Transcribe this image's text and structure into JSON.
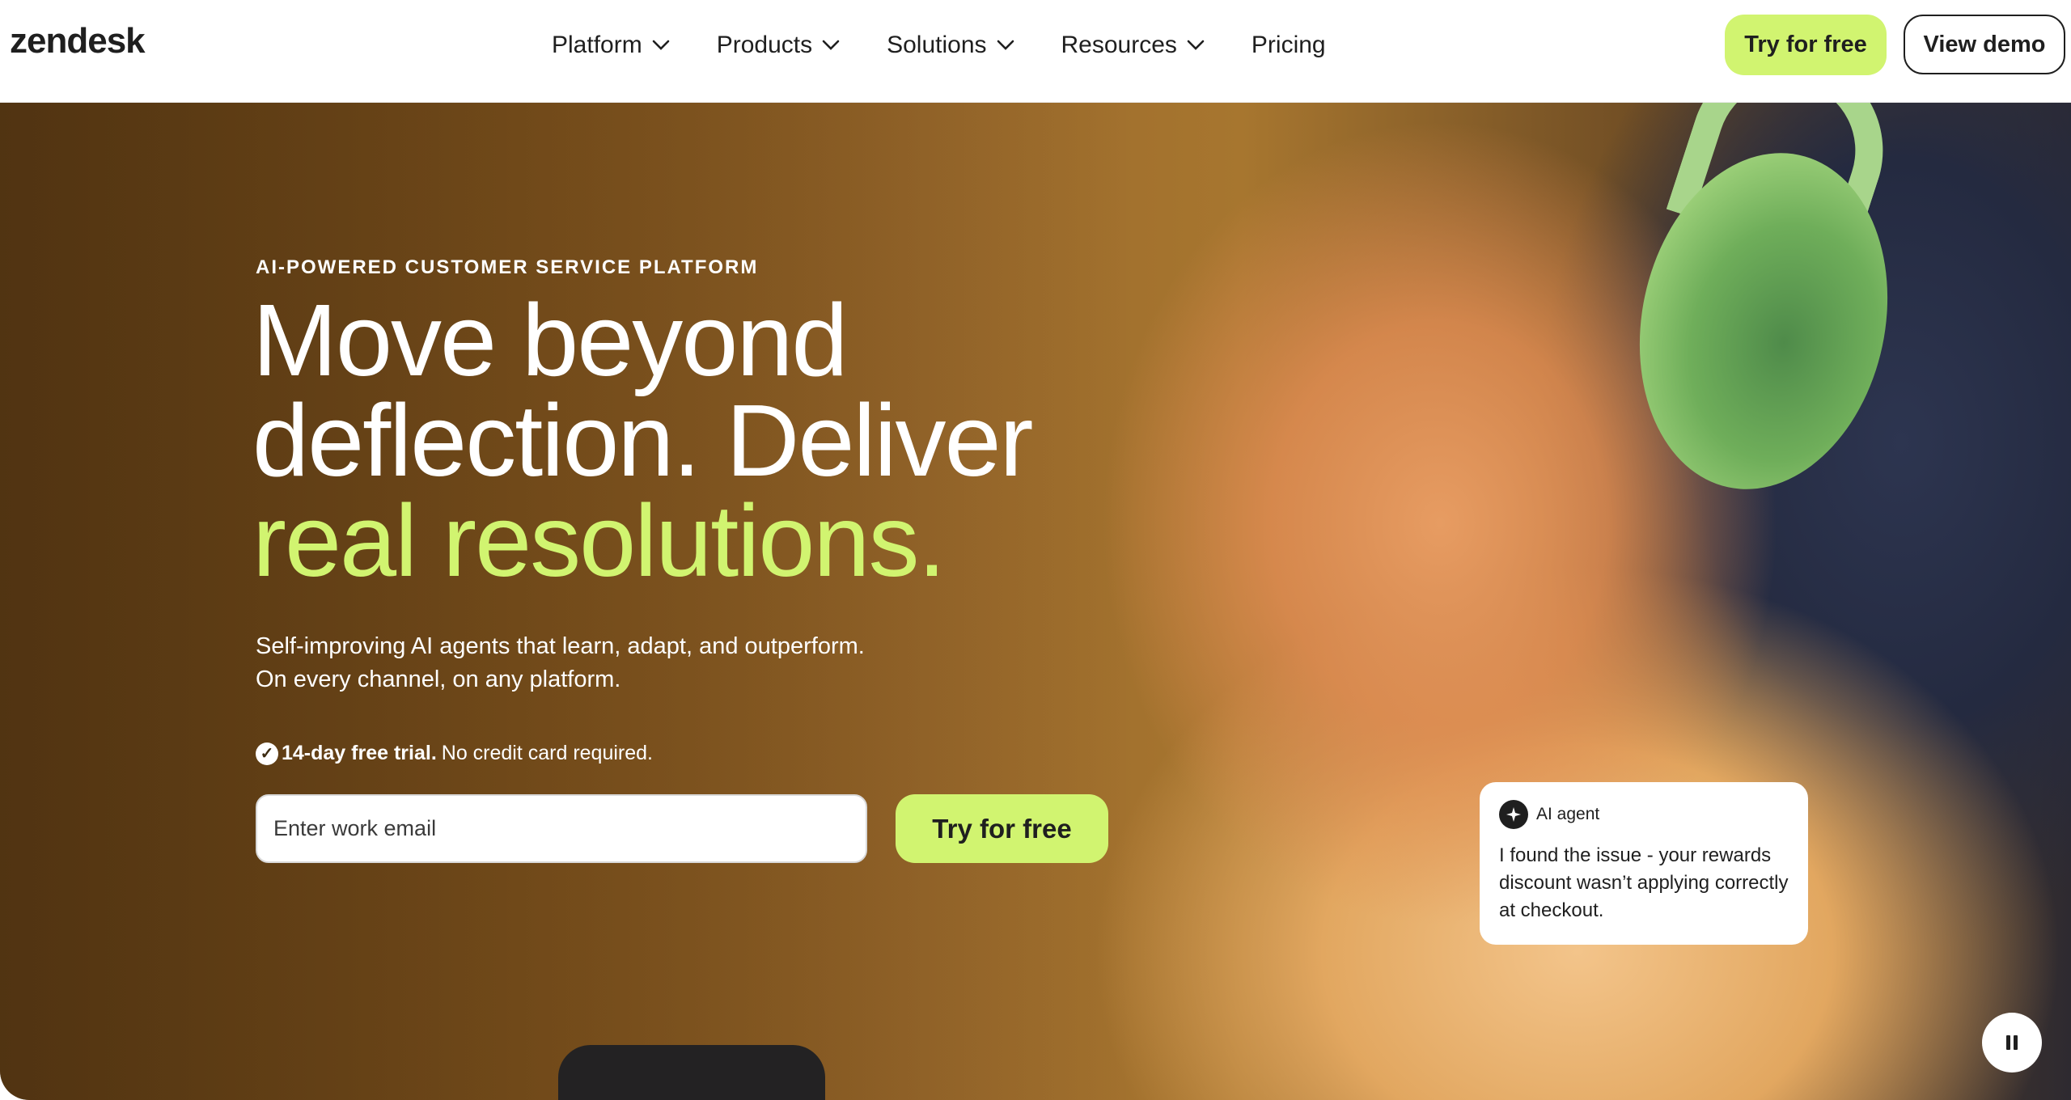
{
  "header": {
    "logo": "zendesk",
    "nav": [
      {
        "label": "Platform",
        "has_dropdown": true
      },
      {
        "label": "Products",
        "has_dropdown": true
      },
      {
        "label": "Solutions",
        "has_dropdown": true
      },
      {
        "label": "Resources",
        "has_dropdown": true
      },
      {
        "label": "Pricing",
        "has_dropdown": false
      }
    ],
    "try_label": "Try for free",
    "demo_label": "View demo"
  },
  "hero": {
    "eyebrow": "AI-POWERED CUSTOMER SERVICE PLATFORM",
    "headline_line1": "Move beyond",
    "headline_line2": "deflection. Deliver",
    "headline_accent": "real resolutions.",
    "subtext_line1": "Self-improving AI agents that learn, adapt, and outperform.",
    "subtext_line2": "On every channel, on any platform.",
    "trial_bold": "14-day free trial.",
    "trial_rest": "No credit card required.",
    "email_placeholder": "Enter work email",
    "cta_label": "Try for free"
  },
  "ai_card": {
    "title": "AI agent",
    "message": "I found the issue - your rewards discount wasn’t applying correctly at checkout."
  },
  "colors": {
    "accent": "#d1f470",
    "text": "#1f1f1f",
    "background": "#ffffff"
  },
  "icons": {
    "chevron": "chevron-down-icon",
    "check": "check-circle-icon",
    "ai": "ai-agent-icon",
    "pause": "pause-icon"
  }
}
